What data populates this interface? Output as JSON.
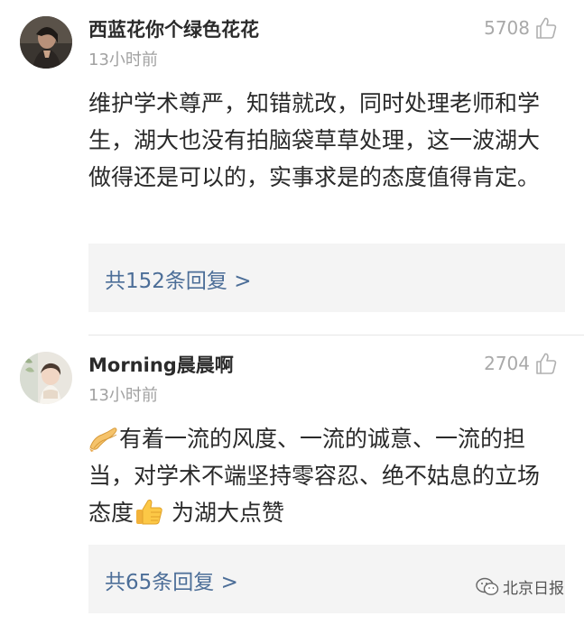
{
  "comments": [
    {
      "username": "西蓝花你个绿色花花",
      "time": "13小时前",
      "likes": "5708",
      "text": "维护学术尊严，知错就改，同时处理老师和学生，湖大也没有拍脑袋草草处理，这一波湖大做得还是可以的，实事求是的态度值得肯定。",
      "replies": "共152条回复 >"
    },
    {
      "username": "Morning晨晨啊",
      "time": "13小时前",
      "likes": "2704",
      "text_main": "有着一流的风度、一流的诚意、一流的担当，对学术不端坚持零容忍、绝不姑息的立场态度",
      "text_tail": " 为湖大点赞",
      "lead_emoji": "praying-hands-icon",
      "inline_emoji": "thumbs-up-icon",
      "replies": "共65条回复 >"
    }
  ],
  "watermark": "北京日报",
  "colors": {
    "username": "#2b2b2b",
    "timestamp": "#a2a2a2",
    "like": "#a9a9a9",
    "reply_link": "#4c6e98",
    "reply_bg": "#f4f4f4"
  }
}
